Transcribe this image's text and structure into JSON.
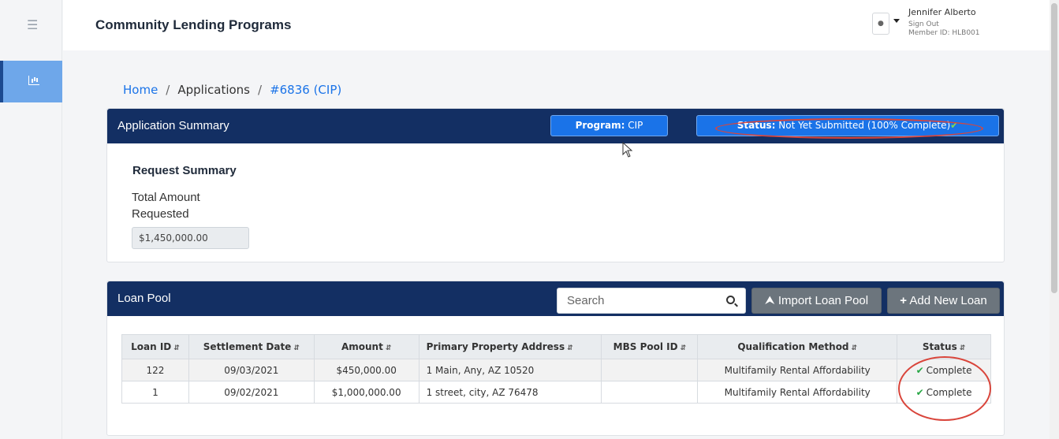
{
  "app": {
    "title": "Community Lending Programs"
  },
  "user": {
    "name": "Jennifer Alberto",
    "sign_out": "Sign Out",
    "member_id": "Member ID: HLB001"
  },
  "breadcrumb": {
    "home": "Home",
    "sep1": "/",
    "applications": "Applications",
    "sep2": "/",
    "current": "#6836 (CIP)"
  },
  "summary": {
    "title": "Application Summary",
    "program_label": "Program:",
    "program_value": "CIP",
    "status_label": "Status:",
    "status_value": "Not Yet Submitted (100% Complete)",
    "status_icon": "check-icon",
    "request_title": "Request Summary",
    "total_label": "Total Amount Requested",
    "total_value": "$1,450,000.00"
  },
  "loan_pool": {
    "title": "Loan Pool",
    "search_placeholder": "Search",
    "import_label": "Import Loan Pool",
    "add_label": "Add New Loan",
    "columns": [
      "Loan ID",
      "Settlement Date",
      "Amount",
      "Primary Property Address",
      "MBS Pool ID",
      "Qualification Method",
      "Status"
    ],
    "rows": [
      {
        "loan_id": "122",
        "settlement_date": "09/03/2021",
        "amount": "$450,000.00",
        "address": "1 Main, Any, AZ 10520",
        "mbs_pool_id": "",
        "qualification": "Multifamily Rental Affordability",
        "status": "Complete"
      },
      {
        "loan_id": "1",
        "settlement_date": "09/02/2021",
        "amount": "$1,000,000.00",
        "address": "1 street, city, AZ 76478",
        "mbs_pool_id": "",
        "qualification": "Multifamily Rental Affordability",
        "status": "Complete"
      }
    ]
  },
  "colors": {
    "header_navy": "#132f63",
    "accent_blue": "#1a73e8",
    "annotation_red": "#d9453b",
    "complete_green": "#28a745"
  }
}
